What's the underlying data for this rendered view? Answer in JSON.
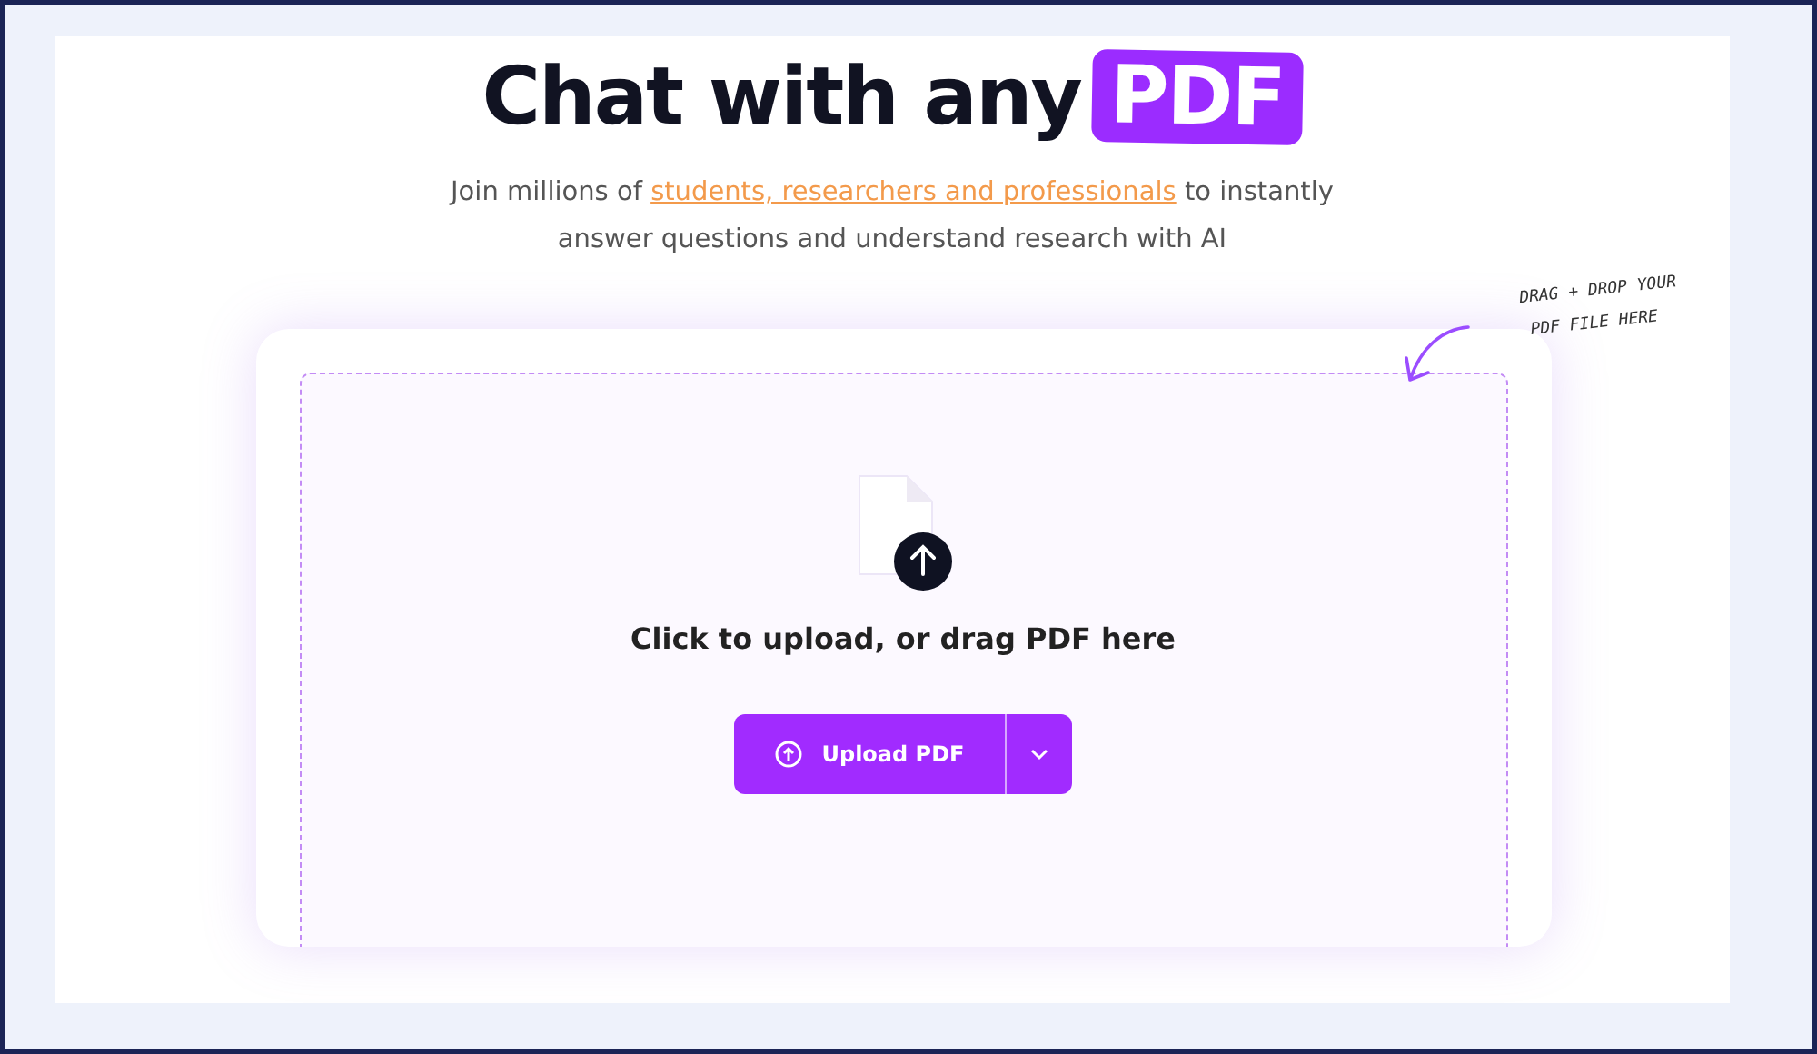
{
  "hero": {
    "title": "Chat with any",
    "title_highlight": "PDF",
    "subtitle_before": "Join millions of",
    "subtitle_link": "students, researchers and professionals",
    "subtitle_after": "to instantly answer questions and understand research with AI"
  },
  "annotation": {
    "lines": [
      "DRAG + DROP YOUR",
      "PDF FILE HERE"
    ]
  },
  "dropzone": {
    "prompt": "Click to upload, or drag PDF here",
    "button": "Upload PDF"
  }
}
